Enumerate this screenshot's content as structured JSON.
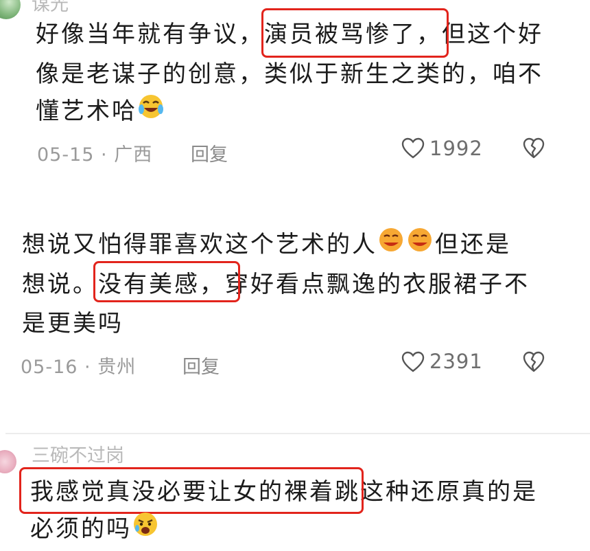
{
  "colors": {
    "highlight": "#e2241c",
    "meta": "#9a9a9a",
    "text": "#1b1b1b"
  },
  "comments": [
    {
      "username": "谋光",
      "line1_pre": "好像当年就有争议，",
      "line1_highlight": "演员被骂惨了，",
      "line1_post": "但这个好",
      "line2": "像是老谋子的创意，类似于新生之类的，咱不",
      "line3": "懂艺术哈",
      "emoji": "laughing-tears-emoji",
      "date": "05-15",
      "location": "广西",
      "reply_label": "回复",
      "likes": "1992"
    },
    {
      "line1": "想说又怕得罪喜欢这个艺术的人",
      "line1_post": "但还是",
      "line2_pre": "想说。",
      "line2_highlight": "没有美感，",
      "line2_post": "穿好看点飘逸的衣服裙子不",
      "line3": "是更美吗",
      "emoji": "grinning-face-emoji",
      "date": "05-16",
      "location": "贵州",
      "reply_label": "回复",
      "likes": "2391"
    },
    {
      "username": "三碗不过岗",
      "line1_highlight": "我感觉真没必要让女的裸着跳",
      "line1_post": "这种还原真的是",
      "line2": "必须的吗",
      "emoji": "anguished-face-emoji"
    }
  ]
}
